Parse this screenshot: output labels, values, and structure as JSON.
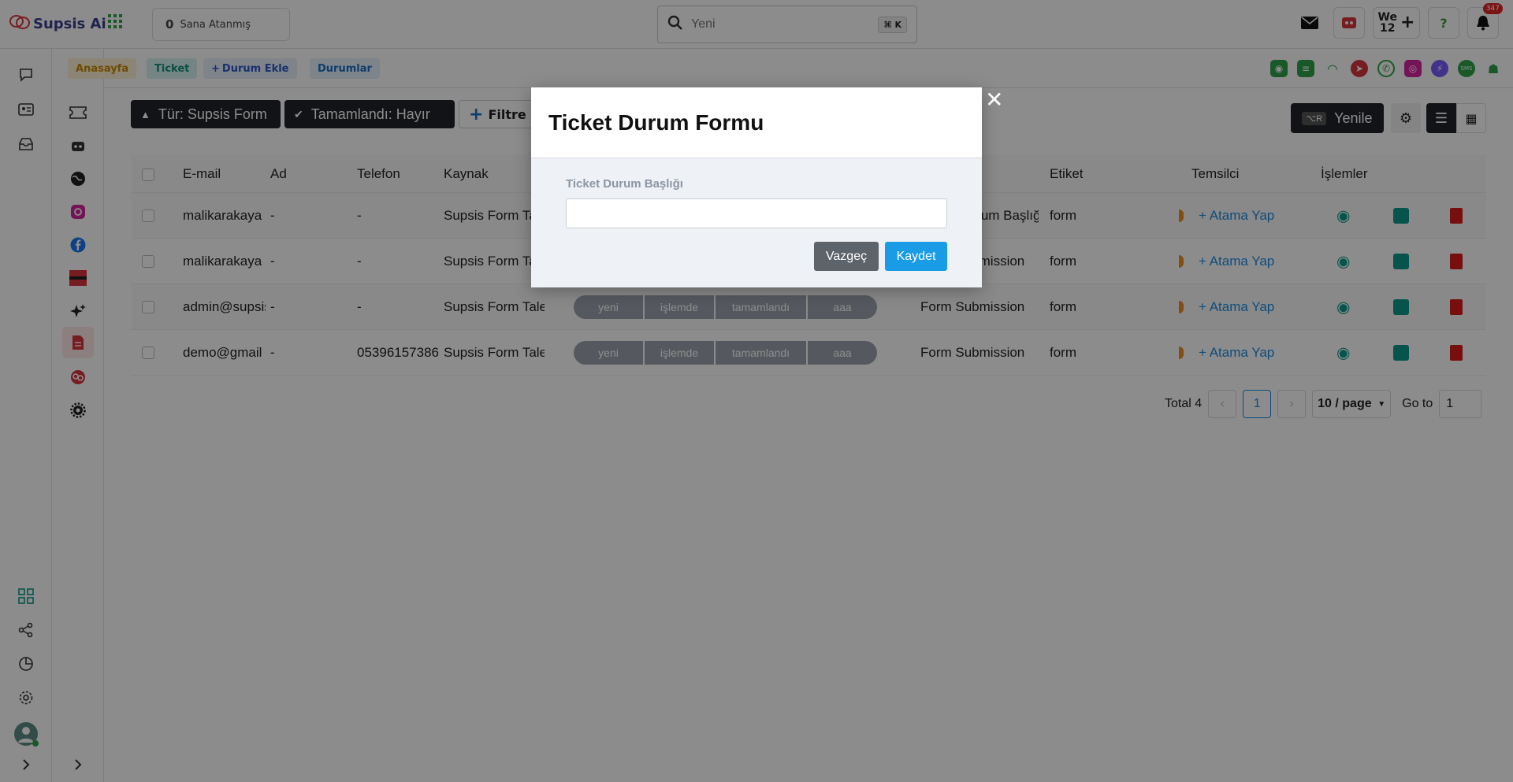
{
  "app": {
    "logo_text": "Supsis Ai"
  },
  "topbar": {
    "assigned_count": "0",
    "assigned_label": "Sana Atanmış",
    "search_placeholder": "Yeni",
    "search_shortcut": "⌘ K",
    "we_label": "We",
    "we_count": "12",
    "notification_count": "347"
  },
  "breadcrumbs": {
    "home": "Anasayfa",
    "ticket": "Ticket",
    "add_status": "Durum Ekle",
    "statuses": "Durumlar"
  },
  "filters": {
    "type_filter": "Tür: Supsis Form",
    "done_filter": "Tamamlandı: Hayır",
    "add_filter": "Filtre Ekle",
    "refresh_label": "Yenile",
    "refresh_shortcut": "⌥R"
  },
  "table": {
    "headers": [
      "E-mail",
      "Ad",
      "Telefon",
      "Kaynak",
      "Etiket",
      "Temsilci",
      "İşlemler"
    ],
    "rows": [
      {
        "email": "malikarakaya",
        "name": "-",
        "phone": "-",
        "source": "Supsis Form Talebi",
        "subject": "Ticket Durum Başlığı",
        "tag": "form",
        "assign": "+ Atama Yap"
      },
      {
        "email": "malikarakaya",
        "name": "-",
        "phone": "-",
        "source": "Supsis Form Talebi",
        "subject": "Form Submission",
        "tag": "form",
        "assign": "+ Atama Yap"
      },
      {
        "email": "admin@supsis",
        "name": "-",
        "phone": "-",
        "source": "Supsis Form Talebi",
        "subject": "Form Submission",
        "tag": "form",
        "assign": "+ Atama Yap"
      },
      {
        "email": "demo@gmail",
        "name": "-",
        "phone": "05396157386",
        "source": "Supsis Form Talebi",
        "subject": "Form Submission",
        "tag": "form",
        "assign": "+ Atama Yap"
      }
    ],
    "status_steps": [
      "yeni",
      "işlemde",
      "tamamlandı",
      "aaa"
    ]
  },
  "pagination": {
    "total": "Total 4",
    "current_page": "1",
    "page_size": "10 / page",
    "goto_label": "Go to",
    "goto_value": "1"
  },
  "modal": {
    "title": "Ticket Durum Formu",
    "field_label": "Ticket Durum Başlığı",
    "field_value": "",
    "cancel_label": "Vazgeç",
    "save_label": "Kaydet"
  },
  "colors": {
    "brand_red": "#d9363e",
    "accent_blue": "#1a9be6",
    "teal": "#0e9a8a",
    "danger": "#d91c1c"
  }
}
